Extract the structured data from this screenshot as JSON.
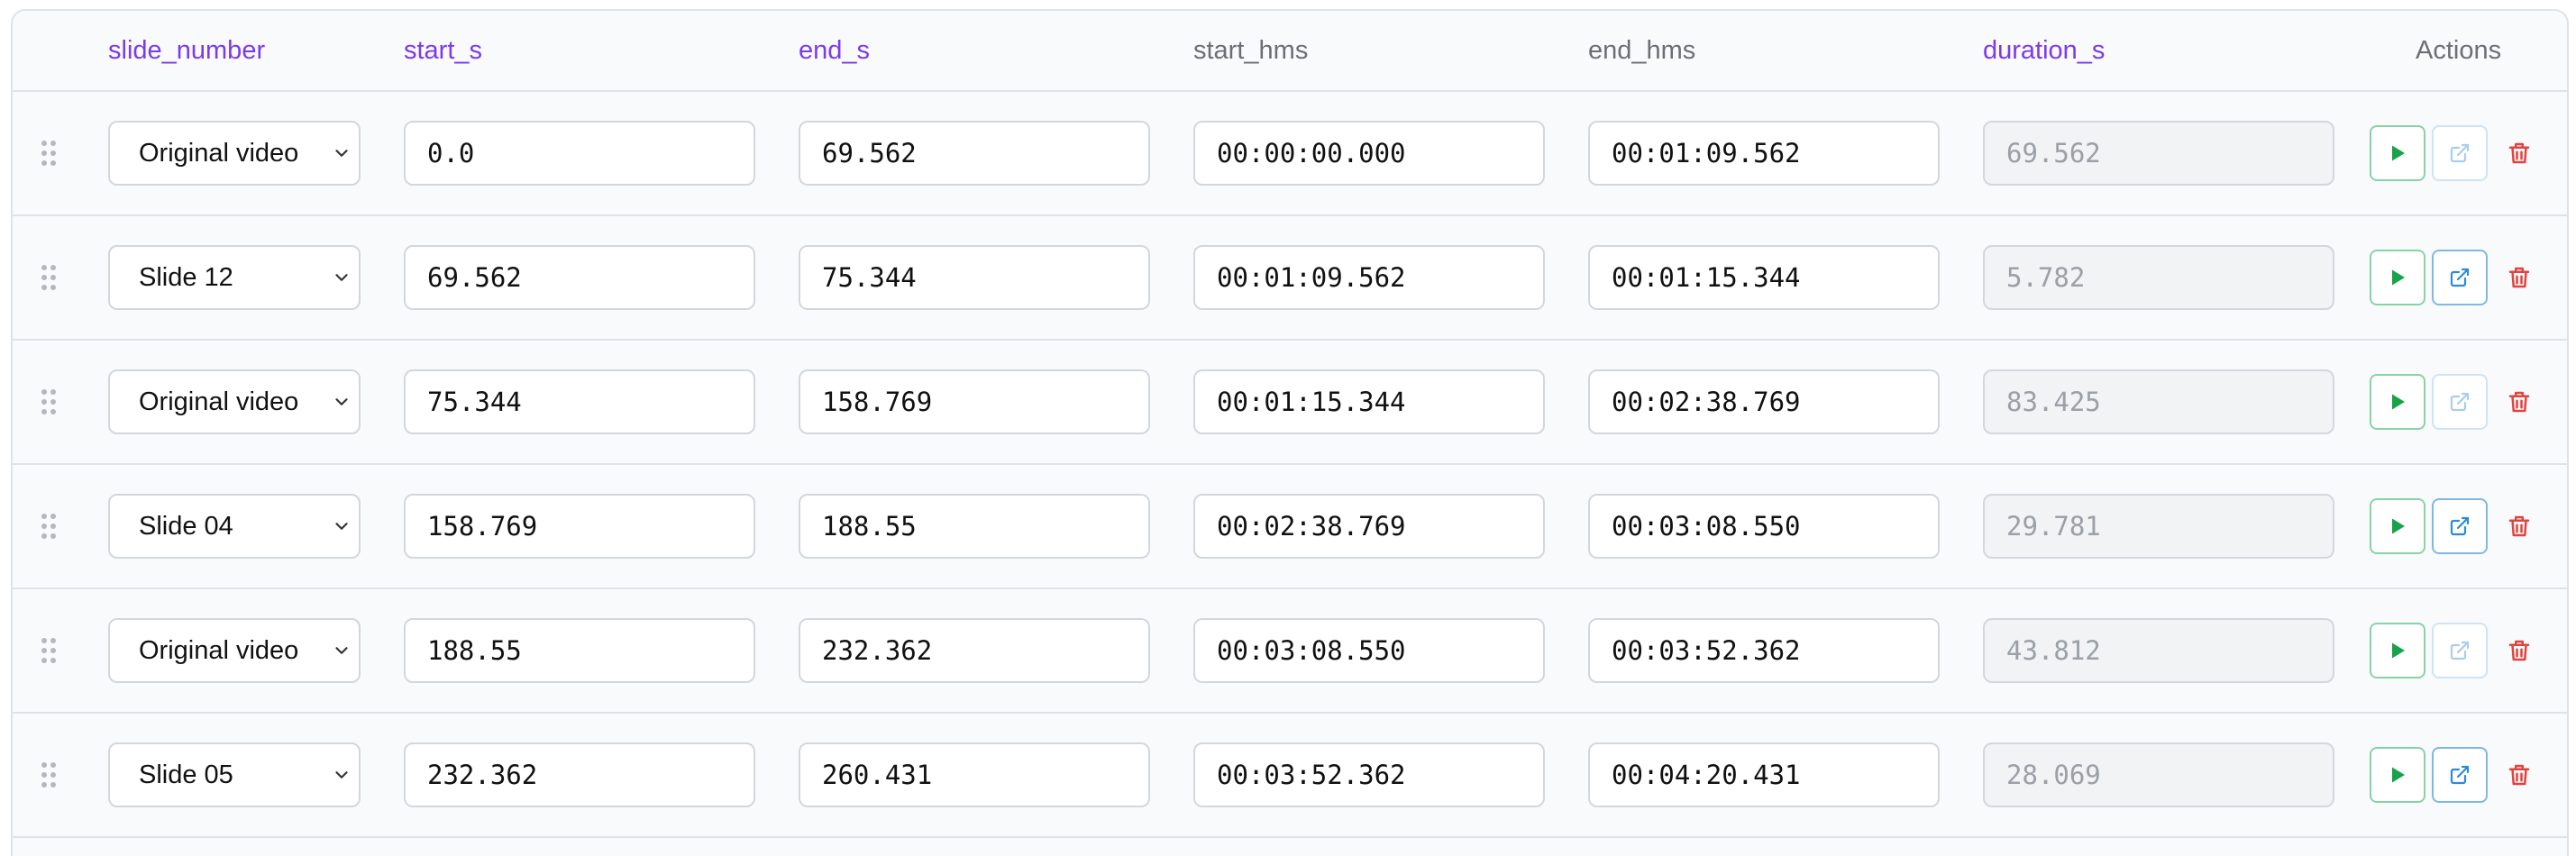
{
  "columns": {
    "slide_number": "slide_number",
    "start_s": "start_s",
    "end_s": "end_s",
    "start_hms": "start_hms",
    "end_hms": "end_hms",
    "duration_s": "duration_s",
    "actions": "Actions"
  },
  "rows": [
    {
      "slide": "Original video",
      "start_s": "0.0",
      "end_s": "69.562",
      "start_hms": "00:00:00.000",
      "end_hms": "00:01:09.562",
      "duration_s": "69.562",
      "open_enabled": false
    },
    {
      "slide": "Slide 12",
      "start_s": "69.562",
      "end_s": "75.344",
      "start_hms": "00:01:09.562",
      "end_hms": "00:01:15.344",
      "duration_s": "5.782",
      "open_enabled": true
    },
    {
      "slide": "Original video",
      "start_s": "75.344",
      "end_s": "158.769",
      "start_hms": "00:01:15.344",
      "end_hms": "00:02:38.769",
      "duration_s": "83.425",
      "open_enabled": false
    },
    {
      "slide": "Slide 04",
      "start_s": "158.769",
      "end_s": "188.55",
      "start_hms": "00:02:38.769",
      "end_hms": "00:03:08.550",
      "duration_s": "29.781",
      "open_enabled": true
    },
    {
      "slide": "Original video",
      "start_s": "188.55",
      "end_s": "232.362",
      "start_hms": "00:03:08.550",
      "end_hms": "00:03:52.362",
      "duration_s": "43.812",
      "open_enabled": false
    },
    {
      "slide": "Slide 05",
      "start_s": "232.362",
      "end_s": "260.431",
      "start_hms": "00:03:52.362",
      "end_hms": "00:04:20.431",
      "duration_s": "28.069",
      "open_enabled": true
    }
  ],
  "icons": {
    "drag": "drag-handle-icon",
    "chevron": "chevron-down-icon",
    "play": "play-icon",
    "open": "external-link-icon",
    "delete": "trash-icon"
  },
  "colors": {
    "accent": "#7c3aed",
    "play": "#16a34a",
    "open": "#2b8bd6",
    "delete": "#e0443e"
  }
}
